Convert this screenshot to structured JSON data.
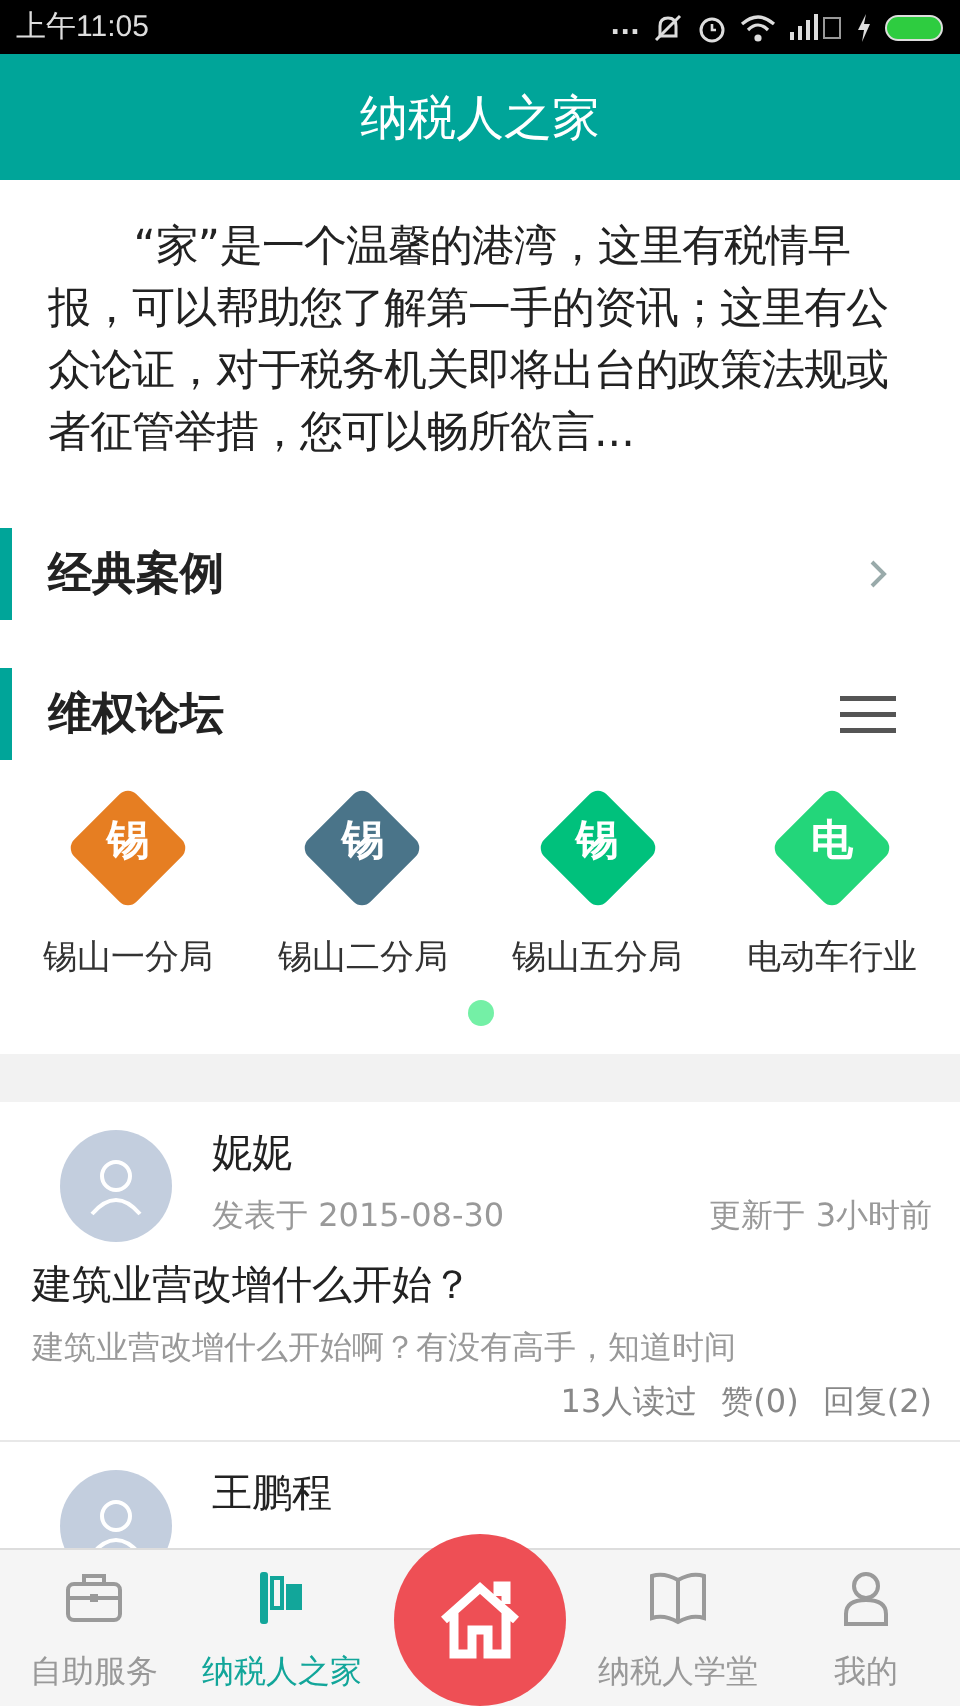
{
  "status_bar": {
    "time": "上午11:05",
    "dots": "..."
  },
  "header": {
    "title": "纳税人之家"
  },
  "intro": "“家”是一个温馨的港湾，这里有税情早报，可以帮助您了解第一手的资讯；这里有公众论证，对于税务机关即将出台的政策法规或者征管举措，您可以畅所欲言...",
  "sections": [
    {
      "title": "经典案例",
      "kind": "link"
    },
    {
      "title": "维权论坛",
      "kind": "menu"
    }
  ],
  "forums": [
    {
      "glyph": "锡",
      "label": "锡山一分局",
      "color": "#e67e22"
    },
    {
      "glyph": "锡",
      "label": "锡山二分局",
      "color": "#4a7489"
    },
    {
      "glyph": "锡",
      "label": "锡山五分局",
      "color": "#00c17c"
    },
    {
      "glyph": "电",
      "label": "电动车行业",
      "color": "#23d67a"
    }
  ],
  "pager": [
    {
      "selected": true
    }
  ],
  "posts": [
    {
      "author": "妮妮",
      "posted": "发表于 2015-08-30",
      "updated": "更新于 3小时前",
      "title": "建筑业营改增什么开始？",
      "excerpt": "建筑业营改增什么开始啊？有没有高手，知道时间",
      "reads": "13人读过",
      "likes": "赞(0)",
      "replies": "回复(2)"
    },
    {
      "author": "王鹏程"
    }
  ],
  "tabs": [
    {
      "kind": "briefcase",
      "label": "自助服务",
      "selected": false
    },
    {
      "kind": "flag",
      "label": "纳税人之家",
      "selected": true
    },
    {
      "kind": "home",
      "selected": false
    },
    {
      "kind": "book",
      "label": "纳税人学堂",
      "selected": false
    },
    {
      "kind": "person",
      "label": "我的",
      "selected": false
    }
  ]
}
